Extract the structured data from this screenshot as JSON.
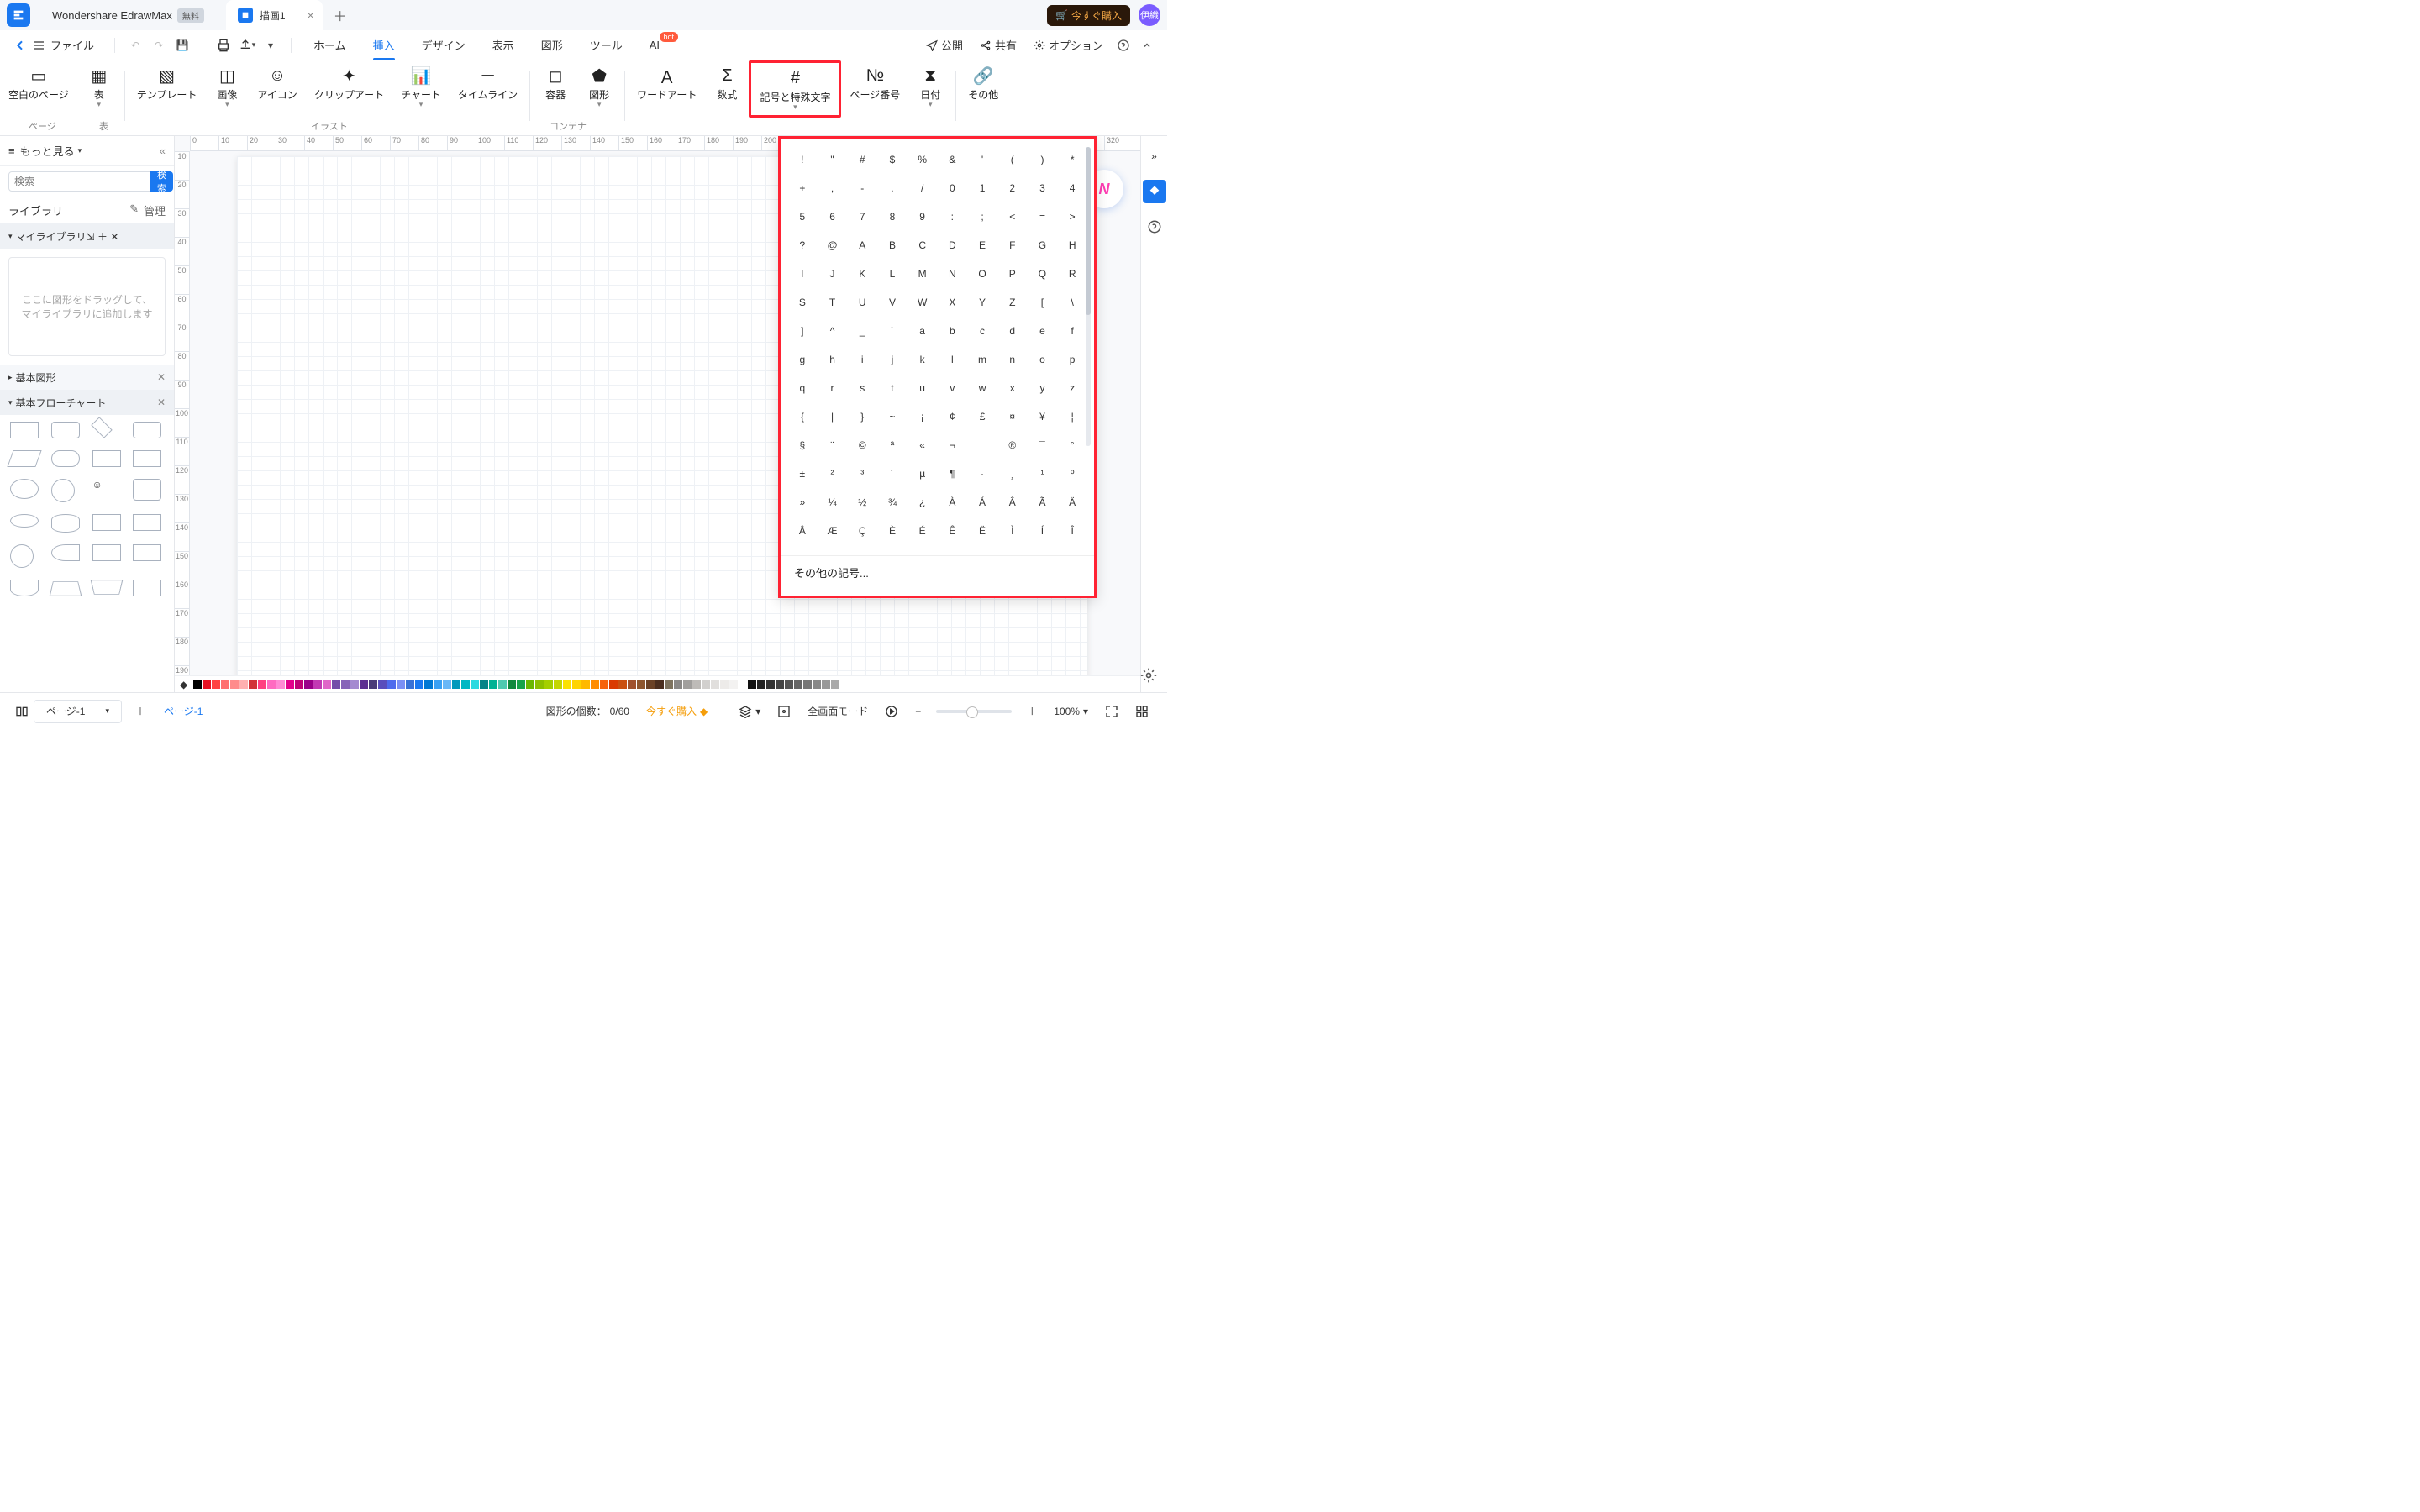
{
  "app": {
    "name": "Wondershare EdrawMax",
    "free": "無料",
    "doc": "描画1"
  },
  "buy": "今すぐ購入",
  "avatar": "伊織",
  "file": "ファイル",
  "topTabs": [
    "ホーム",
    "挿入",
    "デザイン",
    "表示",
    "図形",
    "ツール",
    "AI"
  ],
  "activeTab": 1,
  "hot": "hot",
  "rightMenu": {
    "publish": "公開",
    "share": "共有",
    "options": "オプション"
  },
  "ribbon": {
    "items": [
      {
        "l": "空白のページ"
      },
      {
        "l": "表",
        "c": true
      }
    ],
    "illust": [
      {
        "l": "テンプレート"
      },
      {
        "l": "画像",
        "c": true
      },
      {
        "l": "アイコン"
      },
      {
        "l": "クリップアート"
      },
      {
        "l": "チャート",
        "c": true
      },
      {
        "l": "タイムライン"
      }
    ],
    "container": [
      {
        "l": "容器"
      },
      {
        "l": "図形",
        "c": true
      }
    ],
    "rest": [
      {
        "l": "ワードアート"
      },
      {
        "l": "数式"
      },
      {
        "l": "記号と特殊文字",
        "c": true,
        "hi": true
      },
      {
        "l": "ページ番号"
      },
      {
        "l": "日付",
        "c": true
      }
    ],
    "more": "その他",
    "groups": {
      "page": "ページ",
      "table": "表",
      "illust": "イラスト",
      "container": "コンテナ"
    }
  },
  "left": {
    "more": "もっと見る",
    "searchPH": "検索",
    "searchBtn": "検索",
    "library": "ライブラリ",
    "manage": "管理",
    "mylib": "マイライブラリ",
    "hint": "ここに図形をドラッグして、マイライブラリに追加します",
    "basic": "基本図形",
    "flow": "基本フローチャート"
  },
  "symbols": {
    "other": "その他の記号...",
    "rows": [
      [
        "!",
        "\"",
        "#",
        "$",
        "%",
        "&",
        "'",
        "(",
        ")",
        "*"
      ],
      [
        "+",
        ",",
        "-",
        ".",
        "/",
        "0",
        "1",
        "2",
        "3",
        "4"
      ],
      [
        "5",
        "6",
        "7",
        "8",
        "9",
        ":",
        ";",
        "<",
        "=",
        ">"
      ],
      [
        "?",
        "@",
        "A",
        "B",
        "C",
        "D",
        "E",
        "F",
        "G",
        "H"
      ],
      [
        "I",
        "J",
        "K",
        "L",
        "M",
        "N",
        "O",
        "P",
        "Q",
        "R"
      ],
      [
        "S",
        "T",
        "U",
        "V",
        "W",
        "X",
        "Y",
        "Z",
        "[",
        "\\"
      ],
      [
        "]",
        "^",
        "_",
        "`",
        "a",
        "b",
        "c",
        "d",
        "e",
        "f"
      ],
      [
        "g",
        "h",
        "i",
        "j",
        "k",
        "l",
        "m",
        "n",
        "o",
        "p"
      ],
      [
        "q",
        "r",
        "s",
        "t",
        "u",
        "v",
        "w",
        "x",
        "y",
        "z"
      ],
      [
        "{",
        "|",
        "}",
        "~",
        "¡",
        "¢",
        "£",
        "¤",
        "¥",
        "¦"
      ],
      [
        "§",
        "¨",
        "©",
        "ª",
        "«",
        "¬",
        "­",
        "®",
        "¯",
        "°"
      ],
      [
        "±",
        "²",
        "³",
        "´",
        "µ",
        "¶",
        "·",
        "¸",
        "¹",
        "º"
      ],
      [
        "»",
        "¼",
        "½",
        "¾",
        "¿",
        "À",
        "Á",
        "Â",
        "Ã",
        "Ä"
      ],
      [
        "Å",
        "Æ",
        "Ç",
        "È",
        "É",
        "Ê",
        "Ë",
        "Ì",
        "Í",
        "Î"
      ]
    ]
  },
  "status": {
    "page": "ページ-1",
    "pageLink": "ページ-1",
    "count": "図形の個数：",
    "countVal": "0/60",
    "buy": "今すぐ購入",
    "full": "全画面モード",
    "zoom": "100%"
  },
  "colors": [
    "#000",
    "#e81123",
    "#ff4343",
    "#ff6f6f",
    "#ff8c8c",
    "#ffb0b0",
    "#d13438",
    "#ff4081",
    "#ff6ac1",
    "#ff8ad4",
    "#e3008c",
    "#bf0077",
    "#9a0089",
    "#c239b3",
    "#e065c8",
    "#744da9",
    "#8764b8",
    "#a48ad0",
    "#5c2e91",
    "#4a3b78",
    "#5a4ebc",
    "#4f6bed",
    "#7b8ff5",
    "#3971d6",
    "#1a78f0",
    "#0078d4",
    "#3aa0f3",
    "#69b7f7",
    "#0099bc",
    "#00b7c3",
    "#2ed9e0",
    "#038387",
    "#00b294",
    "#4ec9b0",
    "#10893e",
    "#16a34a",
    "#6bb700",
    "#8cbf00",
    "#a4cf00",
    "#c4d600",
    "#fce100",
    "#ffd400",
    "#ffb900",
    "#ff8c00",
    "#f7630c",
    "#da3b01",
    "#ca5010",
    "#a0522d",
    "#8e562e",
    "#6b4226",
    "#4b2e1e",
    "#7e735f",
    "#8a8886",
    "#a19f9d",
    "#bebbb8",
    "#d2d0ce",
    "#e1dfdd",
    "#edebe9",
    "#f3f2f1",
    "#ffffff",
    "#111",
    "#222",
    "#333",
    "#444",
    "#555",
    "#666",
    "#777",
    "#888",
    "#999",
    "#aaa"
  ]
}
